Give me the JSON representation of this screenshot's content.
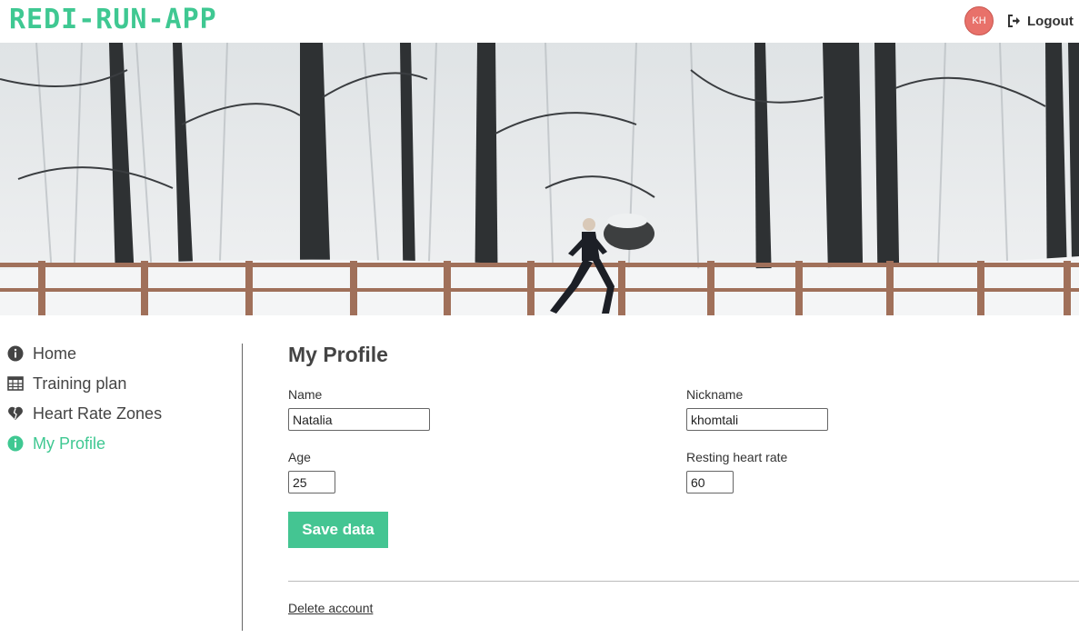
{
  "app": {
    "logo": "REDI-RUN-APP"
  },
  "header": {
    "avatar_initials": "KH",
    "logout_label": "Logout"
  },
  "hero": {
    "alt": "Runner in snowy forest"
  },
  "sidebar": {
    "items": [
      {
        "label": "Home",
        "icon": "info-circle-icon",
        "active": false
      },
      {
        "label": "Training plan",
        "icon": "calendar-table-icon",
        "active": false
      },
      {
        "label": "Heart Rate Zones",
        "icon": "broken-heart-icon",
        "active": false
      },
      {
        "label": "My Profile",
        "icon": "info-circle-icon",
        "active": true
      }
    ]
  },
  "profile": {
    "title": "My Profile",
    "name_label": "Name",
    "name_value": "Natalia",
    "nickname_label": "Nickname",
    "nickname_value": "khomtali",
    "age_label": "Age",
    "age_value": "25",
    "resting_hr_label": "Resting heart rate",
    "resting_hr_value": "60",
    "save_label": "Save data",
    "delete_label": "Delete account"
  },
  "colors": {
    "accent": "#3fc892",
    "avatar": "#e8716a",
    "text": "#444444"
  }
}
